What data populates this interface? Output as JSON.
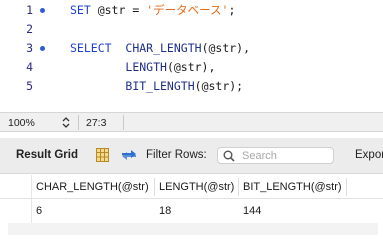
{
  "editor": {
    "lines": [
      {
        "num": "1",
        "has_marker": true,
        "tokens": [
          {
            "t": "SET ",
            "c": "kw"
          },
          {
            "t": "@str",
            "c": "plain"
          },
          {
            "t": " = ",
            "c": "plain"
          },
          {
            "t": "'データベース'",
            "c": "str"
          },
          {
            "t": ";",
            "c": "plain"
          }
        ]
      },
      {
        "num": "2",
        "has_marker": false,
        "tokens": []
      },
      {
        "num": "3",
        "has_marker": true,
        "tokens": [
          {
            "t": "SELECT  ",
            "c": "kw"
          },
          {
            "t": "CHAR_LENGTH",
            "c": "fn"
          },
          {
            "t": "(@str),",
            "c": "plain"
          }
        ]
      },
      {
        "num": "4",
        "has_marker": false,
        "tokens": [
          {
            "t": "        ",
            "c": "plain"
          },
          {
            "t": "LENGTH",
            "c": "fn"
          },
          {
            "t": "(@str),",
            "c": "plain"
          }
        ]
      },
      {
        "num": "5",
        "has_marker": false,
        "tokens": [
          {
            "t": "        ",
            "c": "plain"
          },
          {
            "t": "BIT_LENGTH",
            "c": "fn"
          },
          {
            "t": "(@str);",
            "c": "plain"
          }
        ]
      }
    ]
  },
  "statusbar": {
    "zoom": "100%",
    "cursor": "27:3"
  },
  "result_toolbar": {
    "title": "Result Grid",
    "filter_label": "Filter Rows:",
    "search_placeholder": "Search",
    "export_label": "Export"
  },
  "grid": {
    "columns": [
      "CHAR_LENGTH(@str)",
      "LENGTH(@str)",
      "BIT_LENGTH(@str)"
    ],
    "rows": [
      [
        "6",
        "18",
        "144"
      ]
    ]
  },
  "colors": {
    "keyword": "#1f3fd0",
    "string": "#e06a1a",
    "line_marker": "#2f5bd6"
  },
  "icons": [
    "line-marker-icon",
    "stepper-icon",
    "grid-view-icon",
    "refresh-icon",
    "search-icon"
  ]
}
